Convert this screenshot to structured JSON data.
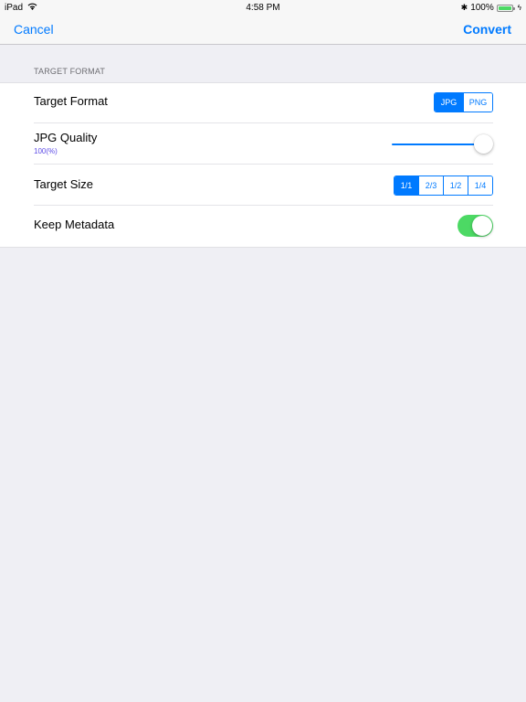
{
  "status_bar": {
    "device": "iPad",
    "time": "4:58 PM",
    "battery_percent": "100%",
    "icons": [
      "wifi-icon",
      "bluetooth-icon",
      "battery-icon",
      "charging-icon"
    ]
  },
  "nav": {
    "cancel_label": "Cancel",
    "convert_label": "Convert",
    "accent_color": "#007aff"
  },
  "section": {
    "header": "TARGET FORMAT",
    "rows": {
      "target_format": {
        "label": "Target Format",
        "options": [
          "JPG",
          "PNG"
        ],
        "selected": "JPG"
      },
      "jpg_quality": {
        "label": "JPG Quality",
        "value_text": "100(%)",
        "slider_value": 1.0
      },
      "target_size": {
        "label": "Target Size",
        "options": [
          "1/1",
          "2/3",
          "1/2",
          "1/4"
        ],
        "selected": "1/1"
      },
      "keep_metadata": {
        "label": "Keep Metadata",
        "on": true,
        "toggle_color": "#4cd964"
      }
    }
  }
}
